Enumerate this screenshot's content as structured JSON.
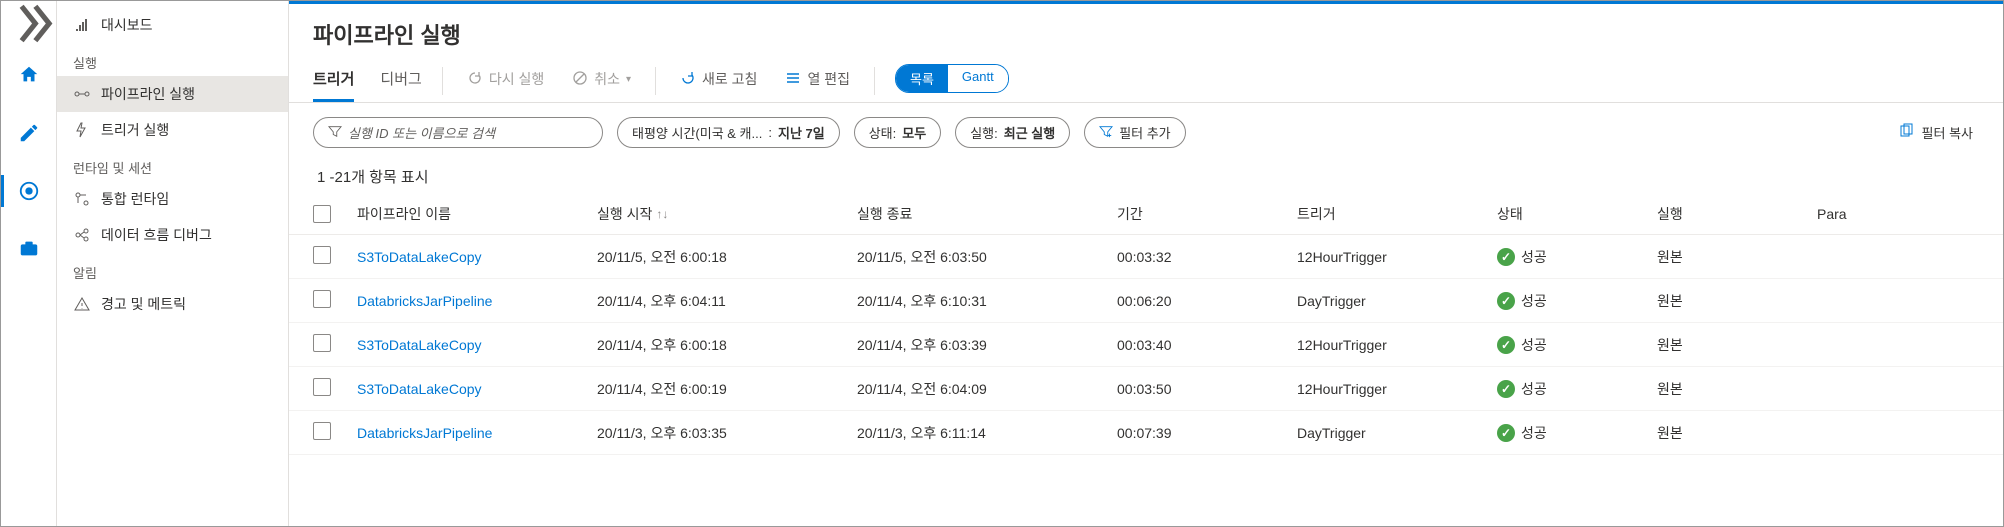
{
  "sidebar": {
    "dashboard": "대시보드",
    "section_runs": "실행",
    "pipeline_runs": "파이프라인 실행",
    "trigger_runs": "트리거 실행",
    "section_runtime": "런타임 및 세션",
    "integration_runtimes": "통합 런타임",
    "dataflow_debug": "데이터 흐름 디버그",
    "section_alerts": "알림",
    "alerts_metrics": "경고 및 메트릭"
  },
  "page": {
    "title": "파이프라인 실행"
  },
  "tabs": {
    "trigger": "트리거",
    "debug": "디버그"
  },
  "toolbar": {
    "rerun": "다시 실행",
    "cancel": "취소",
    "refresh": "새로 고침",
    "edit_columns": "열 편집",
    "view_list": "목록",
    "view_gantt": "Gantt"
  },
  "filters": {
    "search_placeholder": "실행 ID 또는 이름으로 검색",
    "timezone_label": "태평양 시간(미국 & 캐...",
    "timezone_value": "지난 7일",
    "status_label": "상태:",
    "status_value": "모두",
    "runs_label": "실행:",
    "runs_value": "최근 실행",
    "add_filter": "필터 추가",
    "copy_filter": "필터 복사"
  },
  "count_text": "1 -21개 항목 표시",
  "columns": {
    "pipeline_name": "파이프라인 이름",
    "run_start": "실행 시작",
    "run_end": "실행 종료",
    "duration": "기간",
    "trigger": "트리거",
    "status": "상태",
    "run": "실행",
    "params": "Para"
  },
  "rows": [
    {
      "name": "S3ToDataLakeCopy",
      "start": "20/11/5, 오전 6:00:18",
      "end": "20/11/5, 오전 6:03:50",
      "dur": "00:03:32",
      "trigger": "12HourTrigger",
      "status": "성공",
      "run": "원본"
    },
    {
      "name": "DatabricksJarPipeline",
      "start": "20/11/4, 오후 6:04:11",
      "end": "20/11/4, 오후 6:10:31",
      "dur": "00:06:20",
      "trigger": "DayTrigger",
      "status": "성공",
      "run": "원본"
    },
    {
      "name": "S3ToDataLakeCopy",
      "start": "20/11/4, 오후 6:00:18",
      "end": "20/11/4, 오후 6:03:39",
      "dur": "00:03:40",
      "trigger": "12HourTrigger",
      "status": "성공",
      "run": "원본"
    },
    {
      "name": "S3ToDataLakeCopy",
      "start": "20/11/4, 오전 6:00:19",
      "end": "20/11/4, 오전 6:04:09",
      "dur": "00:03:50",
      "trigger": "12HourTrigger",
      "status": "성공",
      "run": "원본"
    },
    {
      "name": "DatabricksJarPipeline",
      "start": "20/11/3, 오후 6:03:35",
      "end": "20/11/3, 오후 6:11:14",
      "dur": "00:07:39",
      "trigger": "DayTrigger",
      "status": "성공",
      "run": "원본"
    }
  ]
}
